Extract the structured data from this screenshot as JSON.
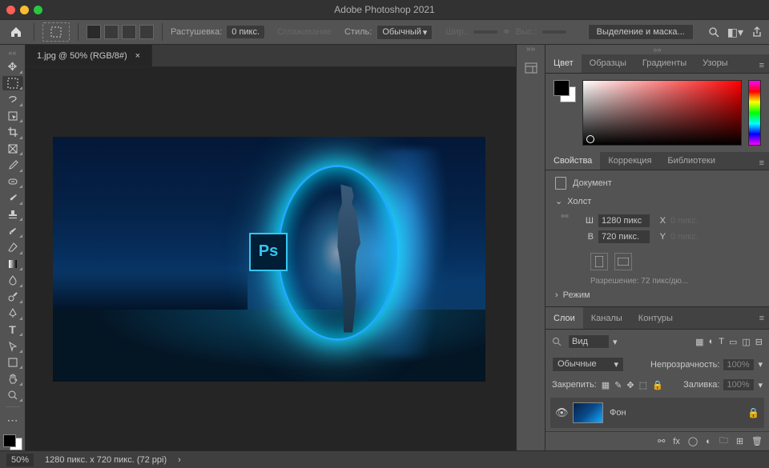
{
  "app_title": "Adobe Photoshop 2021",
  "traffic_lights": {
    "close": "#ff5f57",
    "min": "#febc2e",
    "max": "#28c840"
  },
  "options_bar": {
    "feather_label": "Растушевка:",
    "feather_value": "0 пикс.",
    "antialias_label": "Сглаживание",
    "style_label": "Стиль:",
    "style_value": "Обычный",
    "width_label": "Шир.:",
    "height_label": "Выс.:",
    "mask_button": "Выделение и маска..."
  },
  "document": {
    "tab_title": "1.jpg @ 50% (RGB/8#)",
    "ps_logo": "Ps"
  },
  "color_panel": {
    "tabs": [
      "Цвет",
      "Образцы",
      "Градиенты",
      "Узоры"
    ]
  },
  "properties_panel": {
    "tabs": [
      "Свойства",
      "Коррекция",
      "Библиотеки"
    ],
    "doc_label": "Документ",
    "canvas_label": "Холст",
    "w_label": "Ш",
    "w_value": "1280 пикс",
    "x_label": "X",
    "x_value": "0 пикс.",
    "h_label": "В",
    "h_value": "720 пикс.",
    "y_label": "Y",
    "y_value": "0 пикс.",
    "resolution": "Разрешение: 72 пикс/дю...",
    "mode_label": "Режим"
  },
  "layers_panel": {
    "tabs": [
      "Слои",
      "Каналы",
      "Контуры"
    ],
    "search_kind": "Вид",
    "blend_mode": "Обычные",
    "opacity_label": "Непрозрачность:",
    "opacity_value": "100%",
    "lock_label": "Закрепить:",
    "fill_label": "Заливка:",
    "fill_value": "100%",
    "layer_name": "Фон"
  },
  "status_bar": {
    "zoom": "50%",
    "dims": "1280 пикс. x 720 пикс. (72 ppi)"
  }
}
